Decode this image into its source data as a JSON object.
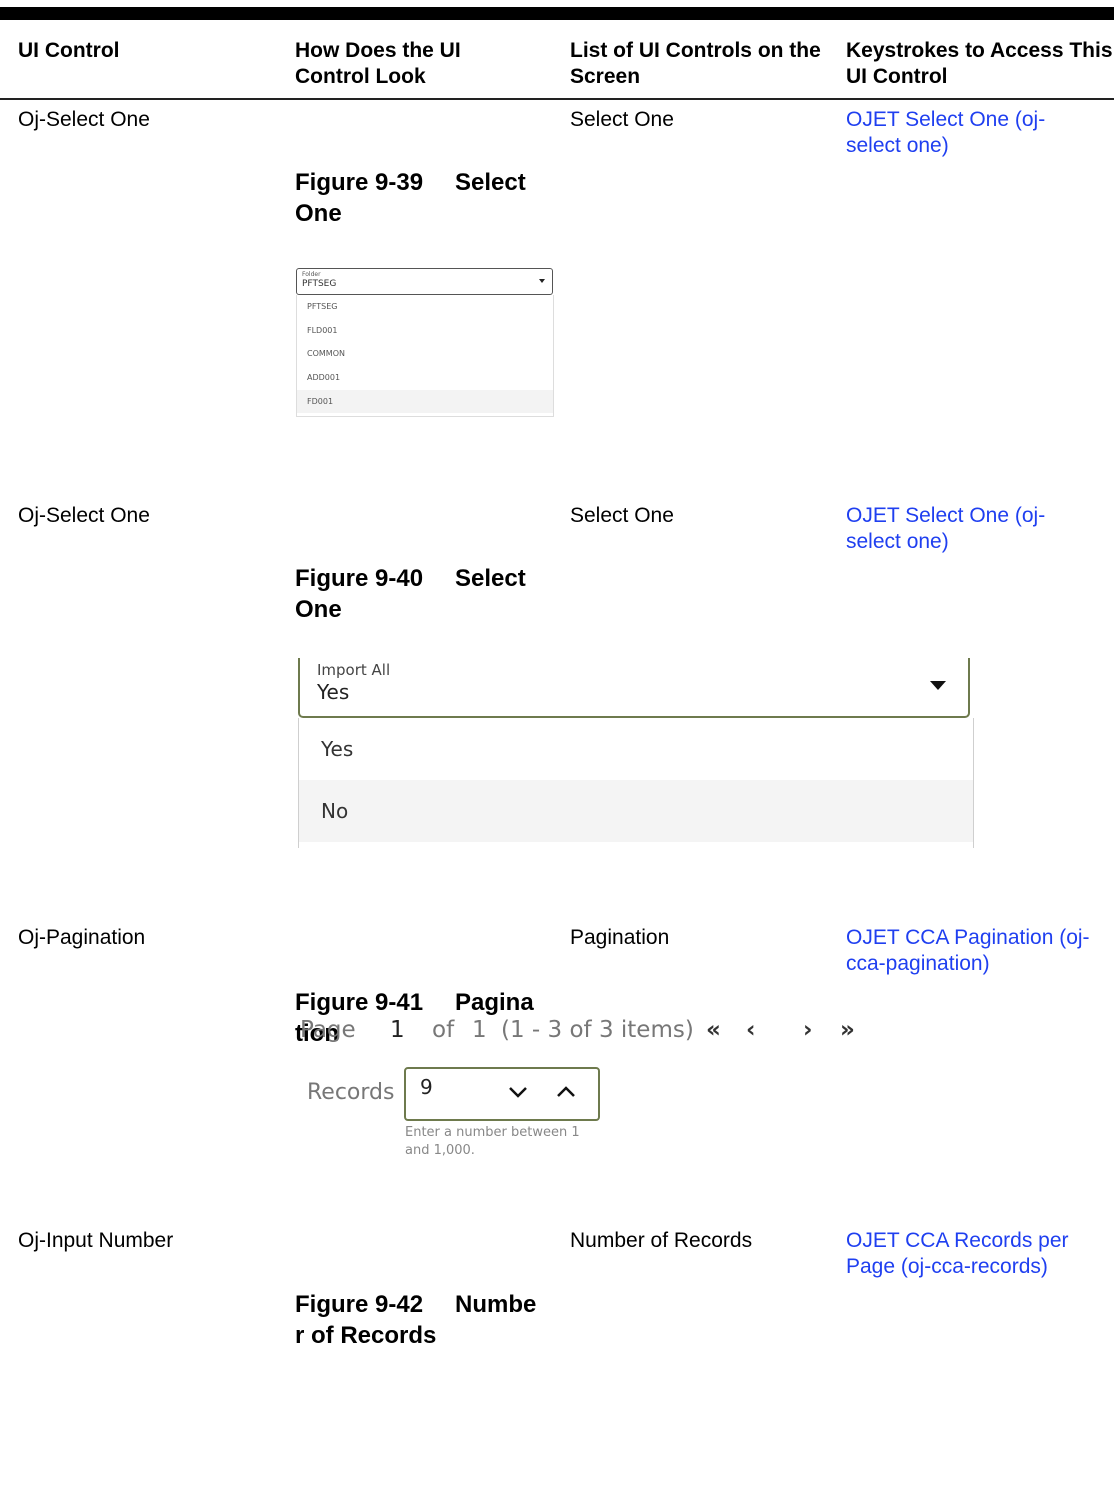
{
  "header": {
    "col1": "UI Control",
    "col2": "How Does the UI Control Look",
    "col3": "List of UI Controls on the Screen",
    "col4": "Keystrokes to Access This UI Control"
  },
  "rows": [
    {
      "control": "Oj-Select One",
      "figure_num": "Figure 9-39",
      "figure_title": "Select One",
      "list": "Select One",
      "link": "OJET Select One (oj-select one)"
    },
    {
      "control": "Oj-Select One",
      "figure_num": "Figure 9-40",
      "figure_title": "Select One",
      "list": "Select One",
      "link": "OJET Select One (oj-select one)"
    },
    {
      "control": "Oj-Pagination",
      "figure_num": "Figure 9-41",
      "figure_title": "Pagination",
      "list": "Pagination",
      "link": "OJET CCA Pagination (oj-cca-pagination)"
    },
    {
      "control": "Oj-Input Number",
      "figure_num": "Figure 9-42",
      "figure_title": "Number of Records",
      "list": "Number of Records",
      "link": "OJET CCA Records per Page (oj-cca-records)"
    }
  ],
  "select_folder": {
    "label": "Folder",
    "value": "PFTSEG",
    "options": [
      "PFTSEG",
      "FLD001",
      "COMMON",
      "ADD001",
      "FD001"
    ]
  },
  "select_import": {
    "label": "Import All",
    "value": "Yes",
    "options": [
      "Yes",
      "No"
    ]
  },
  "pagination": {
    "page_label": "Page",
    "current_page": "1",
    "of_label": "of",
    "total_pages": "1",
    "range": "(1 - 3 of 3 items)",
    "first_icon": "«",
    "prev_icon": "‹",
    "next_icon": "›",
    "last_icon": "»"
  },
  "records": {
    "label": "Records",
    "value": "9",
    "hint": "Enter a number between 1 and 1,000."
  }
}
